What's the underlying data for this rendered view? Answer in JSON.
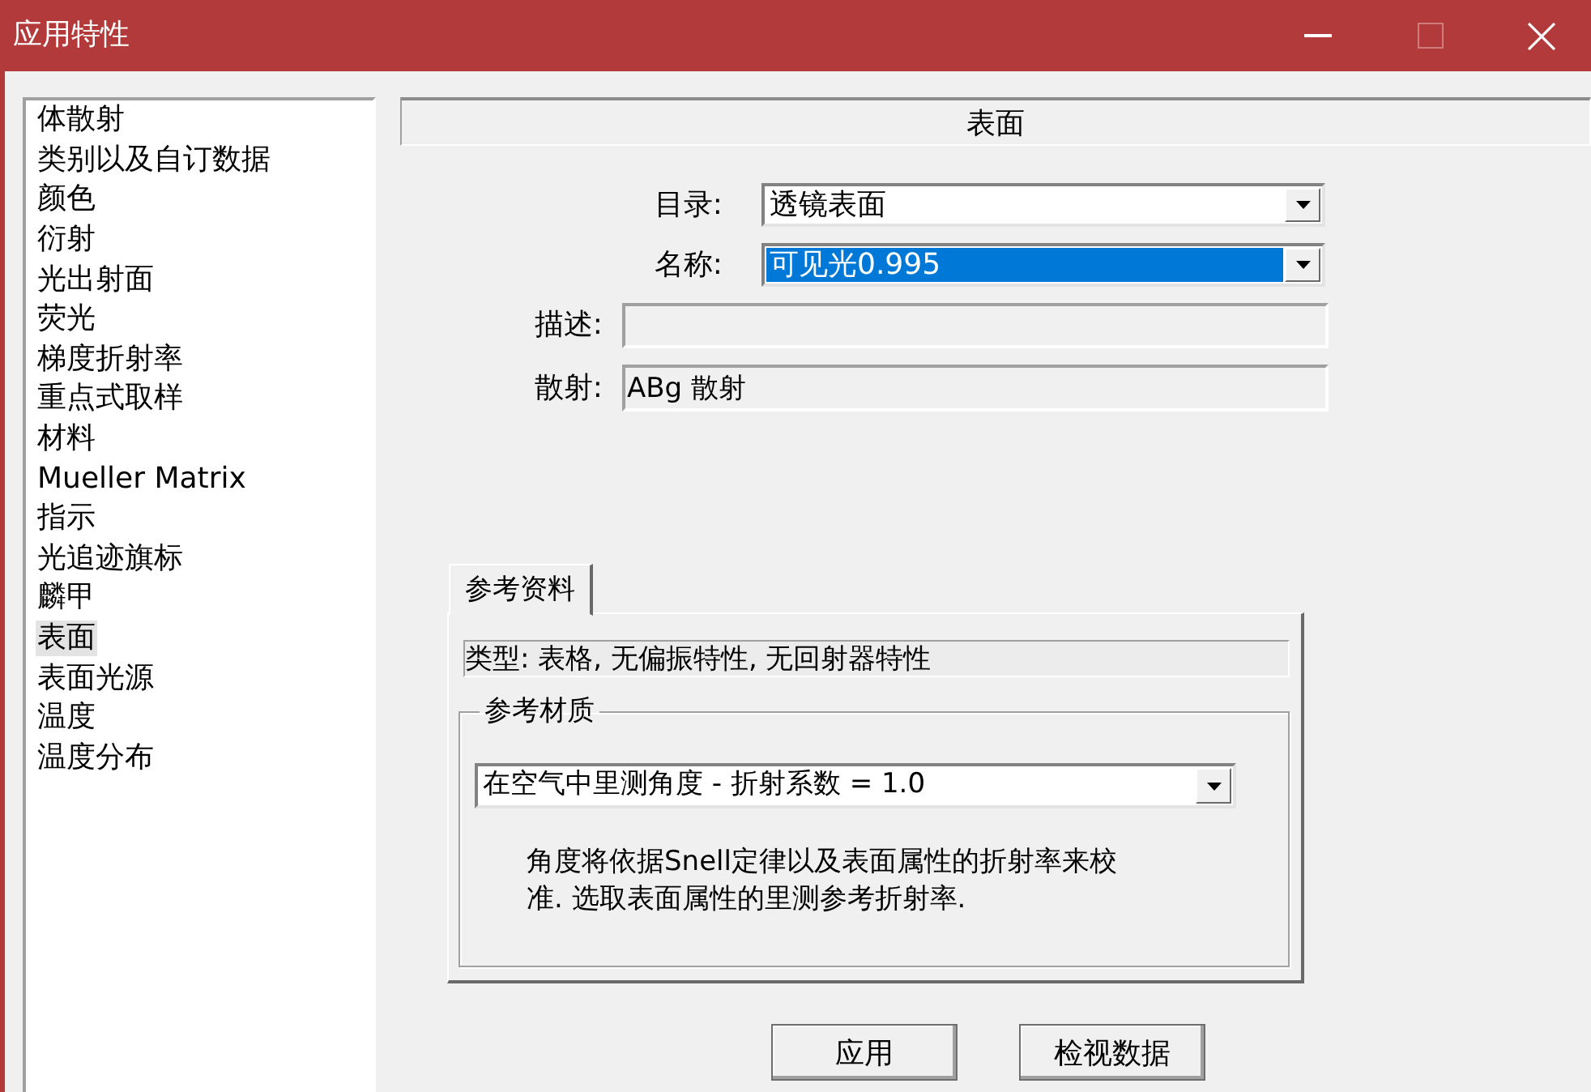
{
  "window": {
    "title": "应用特性",
    "maximize_disabled": true
  },
  "sidebar": {
    "items": [
      {
        "label": "体散射",
        "selected": false
      },
      {
        "label": "类别以及自订数据",
        "selected": false
      },
      {
        "label": "颜色",
        "selected": false
      },
      {
        "label": "衍射",
        "selected": false
      },
      {
        "label": "光出射面",
        "selected": false
      },
      {
        "label": "荧光",
        "selected": false
      },
      {
        "label": "梯度折射率",
        "selected": false
      },
      {
        "label": "重点式取样",
        "selected": false
      },
      {
        "label": "材料",
        "selected": false
      },
      {
        "label": "Mueller Matrix",
        "selected": false
      },
      {
        "label": "指示",
        "selected": false
      },
      {
        "label": "光追迹旗标",
        "selected": false
      },
      {
        "label": "麟甲",
        "selected": false
      },
      {
        "label": "表面",
        "selected": true
      },
      {
        "label": "表面光源",
        "selected": false
      },
      {
        "label": "温度",
        "selected": false
      },
      {
        "label": "温度分布",
        "selected": false
      }
    ]
  },
  "header": {
    "title": "表面"
  },
  "form": {
    "fields": [
      {
        "kind": "combo",
        "label": "目录:",
        "value": "透镜表面",
        "highlighted": false
      },
      {
        "kind": "combo",
        "label": "名称:",
        "value": "可见光0.995",
        "highlighted": true
      },
      {
        "kind": "readonly",
        "label": "描述:",
        "highlighted": false
      },
      {
        "kind": "readonly",
        "label": "散射:",
        "value": "ABg 散射",
        "highlighted": false
      }
    ]
  },
  "tabs": [
    {
      "label": "参考资料",
      "selected": true
    }
  ],
  "reference": {
    "type_text": "类型: 表格, 无偏振特性, 无回射器特性",
    "group_title": "参考材质",
    "combo_value": "在空气中里测角度 - 折射系数 = 1.0",
    "note": "角度将依据Snell定律以及表面属性的折射率来校准. 选取表面属性的里测参考折射率."
  },
  "buttons": [
    {
      "label": "应用"
    },
    {
      "label": "检视数据"
    }
  ]
}
